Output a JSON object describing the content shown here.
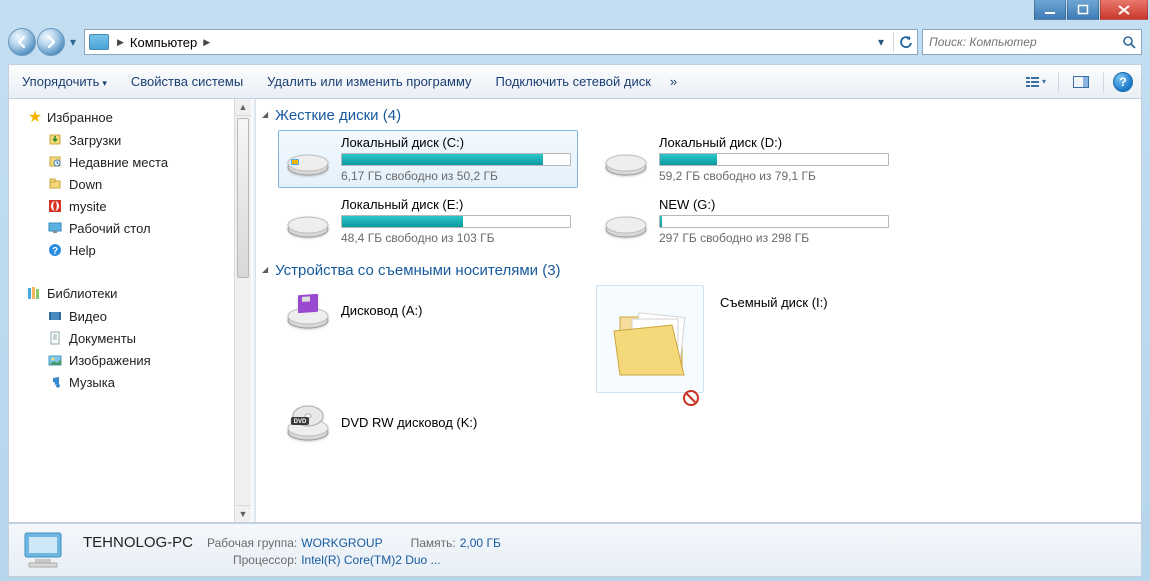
{
  "breadcrumb": {
    "root": "Компьютер"
  },
  "search": {
    "placeholder": "Поиск: Компьютер"
  },
  "toolbar": {
    "organize": "Упорядочить",
    "sys_props": "Свойства системы",
    "uninstall": "Удалить или изменить программу",
    "map_drive": "Подключить сетевой диск",
    "overflow": "»"
  },
  "sidebar": {
    "favorites": {
      "label": "Избранное",
      "items": [
        {
          "label": "Загрузки",
          "icon": "downloads"
        },
        {
          "label": "Недавние места",
          "icon": "recent"
        },
        {
          "label": "Down",
          "icon": "folder"
        },
        {
          "label": "mysite",
          "icon": "opera"
        },
        {
          "label": "Рабочий стол",
          "icon": "desktop"
        },
        {
          "label": "Help",
          "icon": "help"
        }
      ]
    },
    "libraries": {
      "label": "Библиотеки",
      "items": [
        {
          "label": "Видео",
          "icon": "video"
        },
        {
          "label": "Документы",
          "icon": "docs"
        },
        {
          "label": "Изображения",
          "icon": "images"
        },
        {
          "label": "Музыка",
          "icon": "music"
        }
      ]
    }
  },
  "sections": {
    "hdd": {
      "label": "Жесткие диски (4)"
    },
    "removable": {
      "label": "Устройства со съемными носителями (3)"
    }
  },
  "drives": {
    "c": {
      "name": "Локальный диск (C:)",
      "free": "6,17 ГБ свободно из 50,2 ГБ",
      "fill": 88,
      "color": "#0aa3a8",
      "selected": true,
      "os": true
    },
    "d": {
      "name": "Локальный диск (D:)",
      "free": "59,2 ГБ свободно из 79,1 ГБ",
      "fill": 25,
      "color": "#0aa3a8"
    },
    "e": {
      "name": "Локальный диск (E:)",
      "free": "48,4 ГБ свободно из 103 ГБ",
      "fill": 53,
      "color": "#0aa3a8"
    },
    "g": {
      "name": "NEW (G:)",
      "free": "297 ГБ свободно из 298 ГБ",
      "fill": 1,
      "color": "#0aa3a8"
    }
  },
  "removable": {
    "a": {
      "name": "Дисковод (A:)"
    },
    "k": {
      "name": "DVD RW дисковод (K:)"
    },
    "i": {
      "name": "Съемный диск (I:)"
    }
  },
  "status": {
    "host": "TEHNOLOG-PC",
    "wg_label": "Рабочая группа:",
    "wg_value": "WORKGROUP",
    "mem_label": "Память:",
    "mem_value": "2,00 ГБ",
    "cpu_label": "Процессор:",
    "cpu_value": "Intel(R) Core(TM)2 Duo ..."
  }
}
